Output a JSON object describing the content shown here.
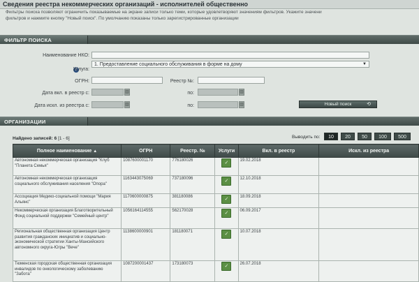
{
  "header": {
    "title": "Сведения реестра некоммерческих организаций - исполнителей общественно"
  },
  "description": {
    "line1": "Фильтры поиска позволяют ограничить показываемые на экране записи только теми, которые удовлетворяют значениям фильтров. Укажите значени",
    "line2": "фильтров и нажмите кнопку \"Новый поиск\". По умолчанию показаны только зарегистрированные организации"
  },
  "filter_section": {
    "title": "ФИЛЬТР ПОИСКА"
  },
  "form": {
    "nko_label": "Наименование НКО:",
    "nko_value": "",
    "service_label": "Услуга:",
    "service_value": "1. Предоставление социального обслуживания в форме на дому",
    "ogrn_label": "ОГРН:",
    "ogrn_value": "",
    "registry_label": "Реестр №:",
    "registry_value": "",
    "date_in_label": "Дата вкл. в реестр с:",
    "date_out_label": "Дата искл. из реестра с:",
    "po_label": "по:",
    "search_button": "Новый поиск"
  },
  "orgs_section": {
    "title": "ОРГАНИЗАЦИИ"
  },
  "results": {
    "found_label": "Найдено записей:",
    "found_count": "6",
    "range": "[1 - 6]",
    "per_page_label": "Выводить по:",
    "per_page_options": [
      "10",
      "20",
      "50",
      "100",
      "500"
    ],
    "per_page_selected": "10"
  },
  "table": {
    "headers": [
      "Полное наименование",
      "ОГРН",
      "Реестр. №",
      "Услуги",
      "Вкл. в реестр",
      "Искл. из реестра"
    ],
    "sort_arrow": "▲",
    "rows": [
      {
        "name": "Автономная некоммерческая организация \"Клуб \"Планета Семья\"",
        "ogrn": "1087600001170",
        "reg": "776180026",
        "date_in": "19.02.2018",
        "date_out": ""
      },
      {
        "name": "Автономная некоммерческая организация социального обслуживания населения \"Опора\"",
        "ogrn": "1163443075069",
        "reg": "737180096",
        "date_in": "12.10.2018",
        "date_out": ""
      },
      {
        "name": "Ассоциация Медико-социальной помощи \"Мария Альянс\"",
        "ogrn": "1170600000875",
        "reg": "381180086",
        "date_in": "18.09.2018",
        "date_out": ""
      },
      {
        "name": "Некоммерческая организация Благотворительный Фонд социальной поддержки \"Семейный центр\"",
        "ogrn": "1056164114555",
        "reg": "562170028",
        "date_in": "06.09.2017",
        "date_out": ""
      },
      {
        "name": "Региональная общественная организация Центр развития гражданских инициатив и социально-экономической стратегии Ханты-Мансийского автономного округа-Югры \"Вече\"",
        "ogrn": "1138600000901",
        "reg": "181180071",
        "date_in": "10.07.2018",
        "date_out": ""
      },
      {
        "name": "Тюменская городская общественная организация инвалидов по онкологическому заболеванию \"Забота\"",
        "ogrn": "1087200001437",
        "reg": "173180073",
        "date_in": "26.07.2018",
        "date_out": ""
      }
    ]
  }
}
